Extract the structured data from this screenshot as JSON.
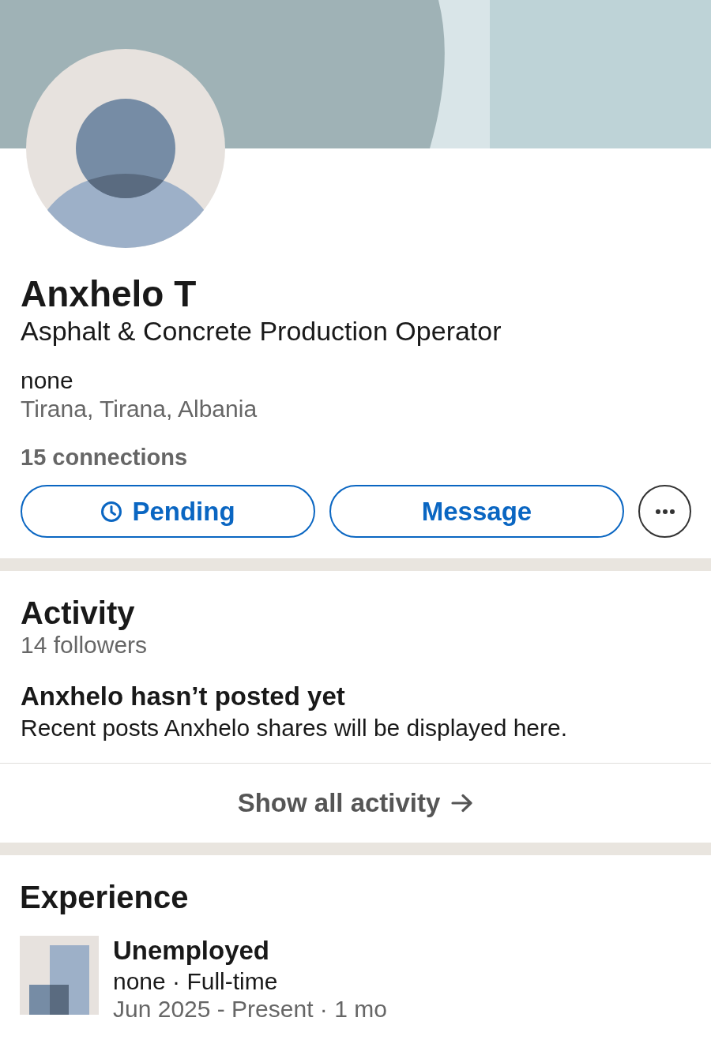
{
  "profile": {
    "name": "Anxhelo T",
    "headline": "Asphalt & Concrete Production Operator",
    "company": "none",
    "location": "Tirana, Tirana, Albania",
    "connections": "15 connections"
  },
  "actions": [
    {
      "kind": "pending",
      "label": "Pending"
    },
    {
      "kind": "message",
      "label": "Message"
    },
    {
      "kind": "more"
    }
  ],
  "activity": {
    "title": "Activity",
    "followers": "14 followers",
    "empty_title": "Anxhelo hasn’t posted yet",
    "empty_text": "Recent posts Anxhelo shares will be displayed here.",
    "show_all": "Show all activity"
  },
  "experience": {
    "title": "Experience",
    "items": [
      {
        "title": "Unemployed",
        "subtitle": "none · Full-time",
        "dates": "Jun 2025 - Present · 1 mo"
      }
    ]
  }
}
